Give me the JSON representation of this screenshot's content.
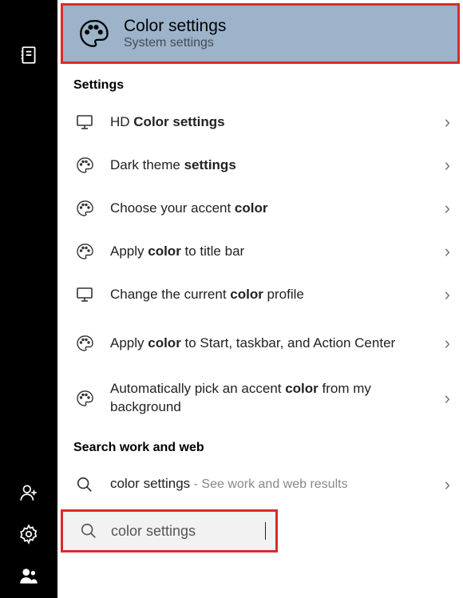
{
  "sidebar": {
    "icons": [
      "dictionary",
      "add-person",
      "gear",
      "people"
    ]
  },
  "bestMatch": {
    "title": "Color settings",
    "subtitle": "System settings"
  },
  "sections": {
    "settings": {
      "header": "Settings",
      "items": [
        {
          "icon": "monitor",
          "html": "HD <b>Color settings</b>"
        },
        {
          "icon": "palette",
          "html": "Dark theme <b>settings</b>"
        },
        {
          "icon": "palette",
          "html": "Choose your accent <b>color</b>"
        },
        {
          "icon": "palette",
          "html": "Apply <b>color</b> to title bar"
        },
        {
          "icon": "monitor",
          "html": "Change the current <b>color</b> profile"
        },
        {
          "icon": "palette",
          "html": "Apply <b>color</b> to Start, taskbar, and Action Center",
          "tall": true
        },
        {
          "icon": "palette",
          "html": "Automatically pick an accent <b>color</b> from my background",
          "tall": true
        }
      ]
    },
    "searchWeb": {
      "header": "Search work and web",
      "item": {
        "icon": "search",
        "text": "color settings",
        "suffix": " - See work and web results"
      }
    }
  },
  "searchBox": {
    "text": "color settings"
  }
}
